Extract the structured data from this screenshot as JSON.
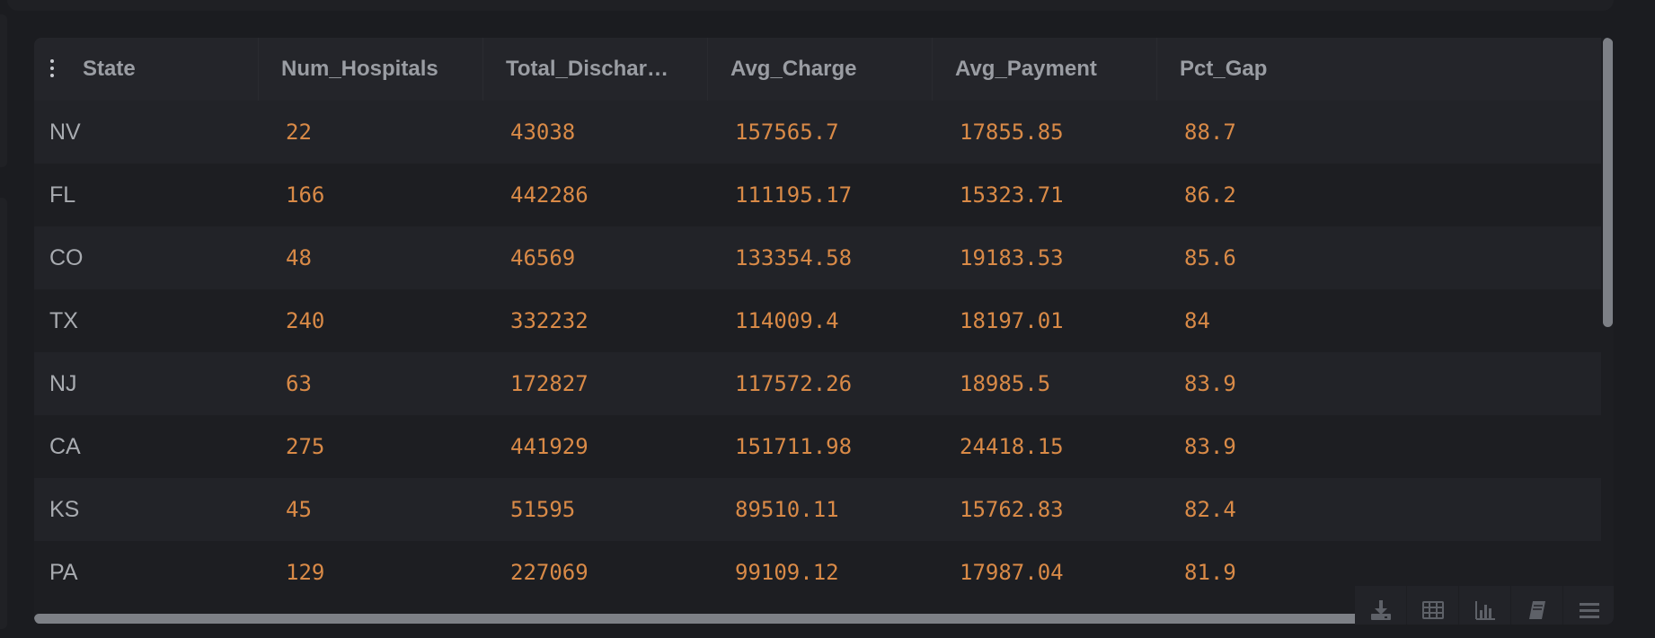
{
  "grid": {
    "columns": [
      "State",
      "Num_Hospitals",
      "Total_Dischar…",
      "Avg_Charge",
      "Avg_Payment",
      "Pct_Gap"
    ],
    "rows": [
      {
        "state": "NV",
        "num_hospitals": "22",
        "total_discharges": "43038",
        "avg_charge": "157565.7",
        "avg_payment": "17855.85",
        "pct_gap": "88.7"
      },
      {
        "state": "FL",
        "num_hospitals": "166",
        "total_discharges": "442286",
        "avg_charge": "111195.17",
        "avg_payment": "15323.71",
        "pct_gap": "86.2"
      },
      {
        "state": "CO",
        "num_hospitals": "48",
        "total_discharges": "46569",
        "avg_charge": "133354.58",
        "avg_payment": "19183.53",
        "pct_gap": "85.6"
      },
      {
        "state": "TX",
        "num_hospitals": "240",
        "total_discharges": "332232",
        "avg_charge": "114009.4",
        "avg_payment": "18197.01",
        "pct_gap": "84"
      },
      {
        "state": "NJ",
        "num_hospitals": "63",
        "total_discharges": "172827",
        "avg_charge": "117572.26",
        "avg_payment": "18985.5",
        "pct_gap": "83.9"
      },
      {
        "state": "CA",
        "num_hospitals": "275",
        "total_discharges": "441929",
        "avg_charge": "151711.98",
        "avg_payment": "24418.15",
        "pct_gap": "83.9"
      },
      {
        "state": "KS",
        "num_hospitals": "45",
        "total_discharges": "51595",
        "avg_charge": "89510.11",
        "avg_payment": "15762.83",
        "pct_gap": "82.4"
      },
      {
        "state": "PA",
        "num_hospitals": "129",
        "total_discharges": "227069",
        "avg_charge": "99109.12",
        "avg_payment": "17987.04",
        "pct_gap": "81.9"
      }
    ]
  },
  "toolbar": {
    "icons": [
      "download-icon",
      "table-icon",
      "bar-chart-icon",
      "notebook-icon",
      "menu-icon"
    ]
  },
  "colors": {
    "background": "#1b1c20",
    "header_bg": "#24252a",
    "header_text": "#9a9da3",
    "state_text": "#a8abb0",
    "number_text": "#d98a47",
    "scrollbar": "#7d8086"
  }
}
